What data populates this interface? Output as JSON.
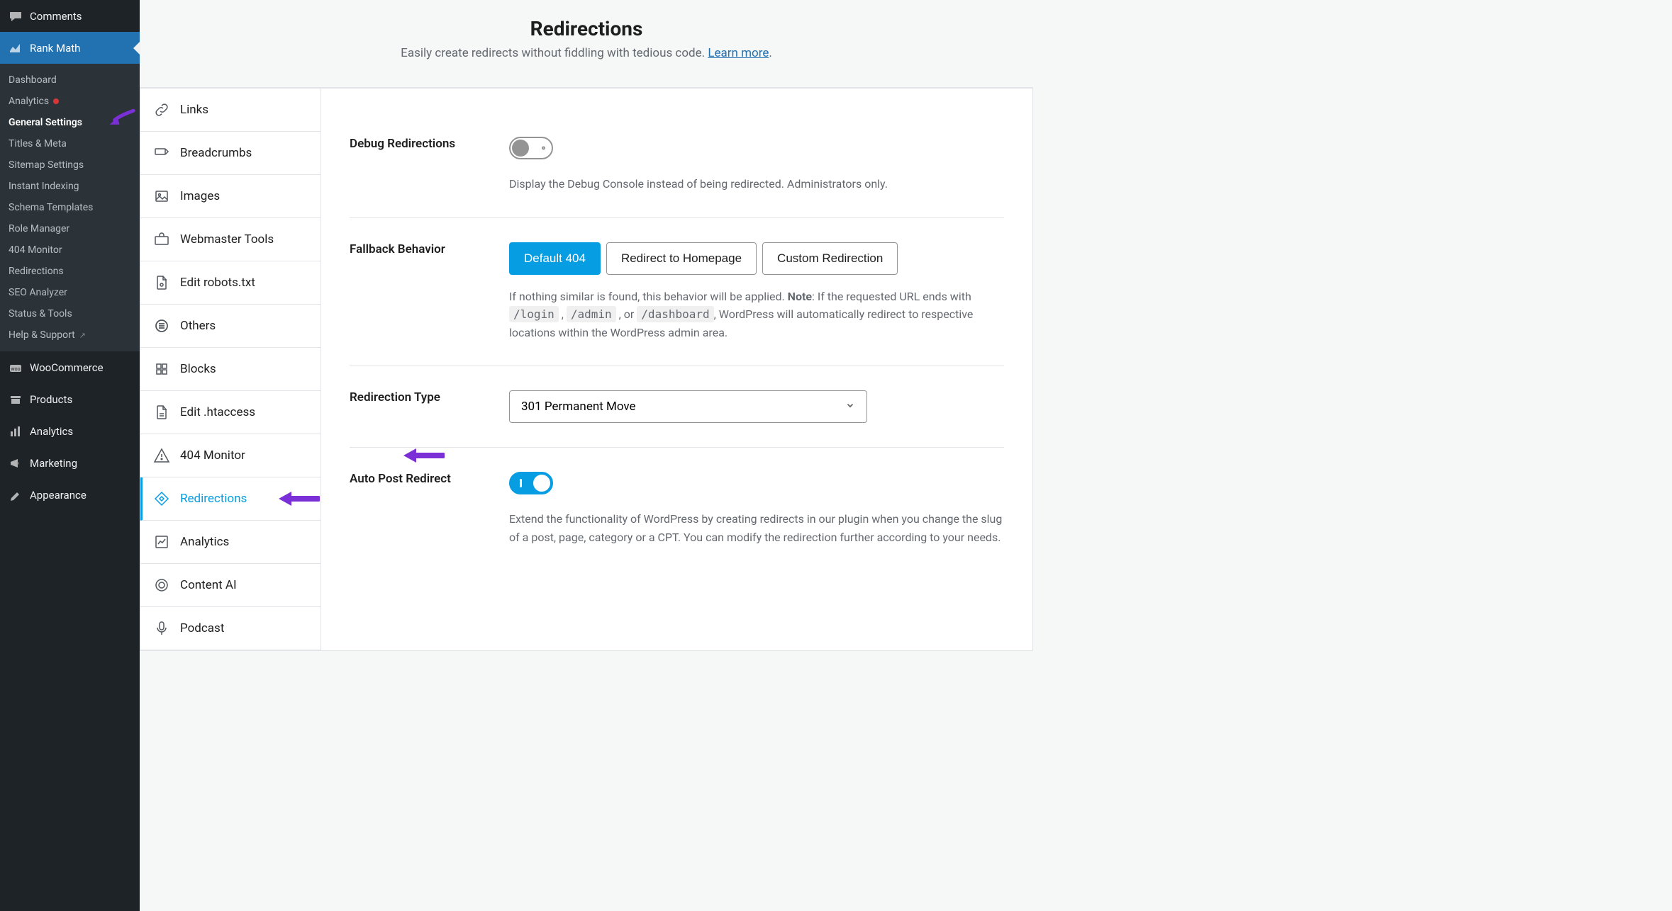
{
  "wp_sidebar": {
    "top": [
      {
        "label": "Comments",
        "icon": "comments"
      },
      {
        "label": "Rank Math",
        "icon": "rank-math",
        "active": true
      }
    ],
    "rank_math_sub": [
      {
        "label": "Dashboard"
      },
      {
        "label": "Analytics",
        "dot": true
      },
      {
        "label": "General Settings",
        "active": true
      },
      {
        "label": "Titles & Meta"
      },
      {
        "label": "Sitemap Settings"
      },
      {
        "label": "Instant Indexing"
      },
      {
        "label": "Schema Templates"
      },
      {
        "label": "Role Manager"
      },
      {
        "label": "404 Monitor"
      },
      {
        "label": "Redirections"
      },
      {
        "label": "SEO Analyzer"
      },
      {
        "label": "Status & Tools"
      },
      {
        "label": "Help & Support",
        "ext": true
      }
    ],
    "bottom": [
      {
        "label": "WooCommerce",
        "icon": "woo"
      },
      {
        "label": "Products",
        "icon": "archive"
      },
      {
        "label": "Analytics",
        "icon": "bar-chart"
      },
      {
        "label": "Marketing",
        "icon": "megaphone"
      },
      {
        "label": "Appearance",
        "icon": "brush"
      }
    ]
  },
  "page_header": {
    "title": "Redirections",
    "subtitle_a": "Easily create redirects without fiddling with tedious code. ",
    "learn_more": "Learn more",
    "subtitle_b": "."
  },
  "settings_tabs": [
    {
      "label": "Links",
      "icon": "links"
    },
    {
      "label": "Breadcrumbs",
      "icon": "breadcrumb"
    },
    {
      "label": "Images",
      "icon": "images"
    },
    {
      "label": "Webmaster Tools",
      "icon": "toolbox"
    },
    {
      "label": "Edit robots.txt",
      "icon": "file-cog"
    },
    {
      "label": "Others",
      "icon": "list"
    },
    {
      "label": "Blocks",
      "icon": "blocks"
    },
    {
      "label": "Edit .htaccess",
      "icon": "file"
    },
    {
      "label": "404 Monitor",
      "icon": "warning"
    },
    {
      "label": "Redirections",
      "icon": "redirect",
      "active": true
    },
    {
      "label": "Analytics",
      "icon": "trend"
    },
    {
      "label": "Content AI",
      "icon": "ai"
    },
    {
      "label": "Podcast",
      "icon": "mic"
    }
  ],
  "fields": {
    "debug_redirections": {
      "label": "Debug Redirections",
      "on": false,
      "help": "Display the Debug Console instead of being redirected. Administrators only."
    },
    "fallback": {
      "label": "Fallback Behavior",
      "options": [
        "Default 404",
        "Redirect to Homepage",
        "Custom Redirection"
      ],
      "selected": 0,
      "help_a": "If nothing similar is found, this behavior will be applied. ",
      "note_label": "Note",
      "help_b": ": If the requested URL ends with ",
      "codes": [
        "/login",
        "/admin",
        "/dashboard"
      ],
      "help_c": ", WordPress will automatically redirect to respective locations within the WordPress admin area.",
      "comma": " , ",
      "or": " , or "
    },
    "redirection_type": {
      "label": "Redirection Type",
      "selected": "301 Permanent Move"
    },
    "auto_post": {
      "label": "Auto Post Redirect",
      "on": true,
      "help": "Extend the functionality of WordPress by creating redirects in our plugin when you change the slug of a post, page, category or a CPT. You can modify the redirection further according to your needs."
    }
  }
}
